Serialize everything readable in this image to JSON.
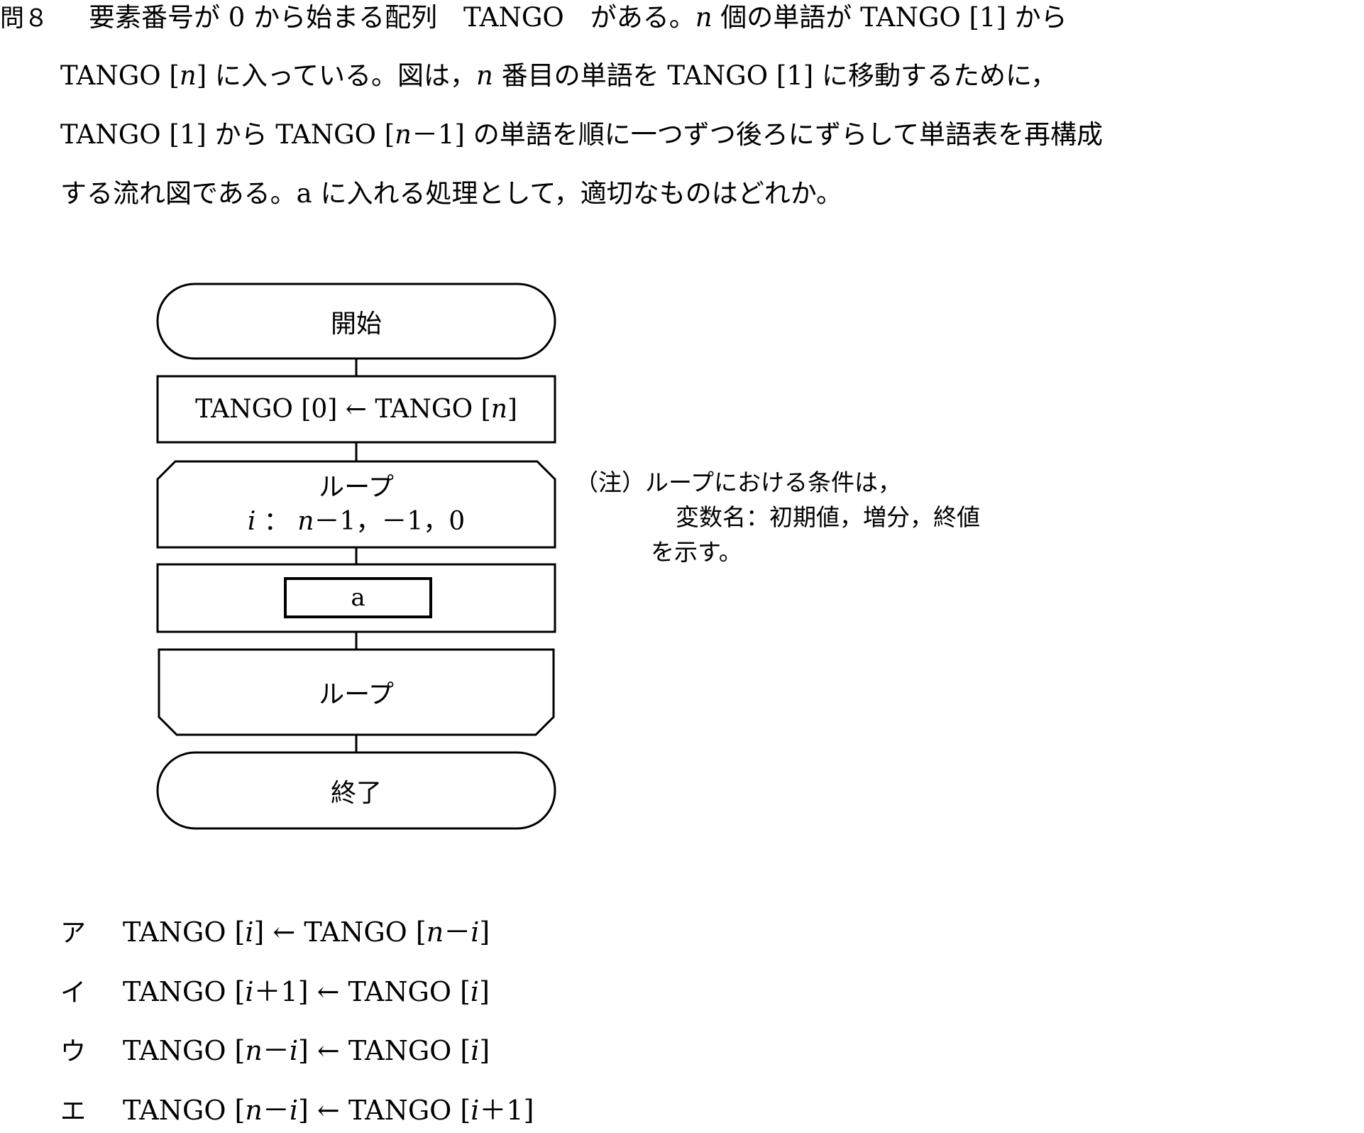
{
  "question": {
    "number": "問８",
    "line1_pre": "要素番号が 0 から始まる配列　TANGO　がある。",
    "line1_var": "n",
    "line1_post": " 個の単語が TANGO [1] から",
    "line2_a": "TANGO [",
    "line2_var1": "n",
    "line2_b": "] に入っている。図は，",
    "line2_var2": "n",
    "line2_c": " 番目の単語を TANGO [1] に移動するために，",
    "line3_a": "TANGO [1] から TANGO [",
    "line3_var": "n",
    "line3_b": "－1] の単語を順に一つずつ後ろにずらして単語表を再構成",
    "line4": "する流れ図である。a に入れる処理として，適切なものはどれか。"
  },
  "flowchart": {
    "start": "開始",
    "assign_pre": "TANGO [0] ← TANGO [",
    "assign_var": "n",
    "assign_post": "]",
    "loop_title": "ループ",
    "loop_var": "i",
    "loop_sep": " ： ",
    "loop_nvar": "n",
    "loop_cond_rest": "－1，－1，0",
    "process": "a",
    "loop_end": "ループ",
    "end": "終了"
  },
  "note": {
    "line1": "（注）ループにおける条件は，",
    "line2": "変数名：初期値，増分，終値",
    "line3": "を示す。"
  },
  "choices": [
    {
      "label": "ア",
      "a": "TANGO [",
      "b": "i",
      "c": "] ← TANGO [",
      "d": "n",
      "e": "－",
      "f": "i",
      "g": "]"
    },
    {
      "label": "イ",
      "a": "TANGO [",
      "b": "i",
      "c": "＋1] ← TANGO [",
      "d": "i",
      "e": "]",
      "f": "",
      "g": ""
    },
    {
      "label": "ウ",
      "a": "TANGO [",
      "b": "n",
      "c": "－",
      "d": "i",
      "e": "] ← TANGO [",
      "f": "i",
      "g": "]"
    },
    {
      "label": "エ",
      "a": "TANGO [",
      "b": "n",
      "c": "－",
      "d": "i",
      "e": "] ← TANGO [",
      "f": "i",
      "g": "＋1]"
    }
  ]
}
